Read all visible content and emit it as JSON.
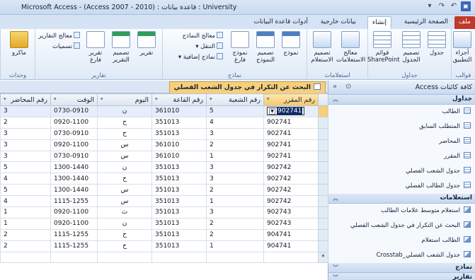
{
  "app": {
    "window_title": "Microsoft Access - (Access 2007 - 2010) : قاعدة بيانات : University"
  },
  "ribbon": {
    "tabs": [
      "ملف",
      "الصفحة الرئيسية",
      "إنشاء",
      "بيانات خارجية",
      "أدوات قاعدة البيانات"
    ],
    "active_tab": "إنشاء",
    "groups": {
      "templates": {
        "label": "قوالب",
        "app_parts": "أجزاء التطبيق"
      },
      "tables": {
        "label": "جداول",
        "table": "جدول",
        "table_design": "تصميم الجدول",
        "sharepoint": "قوائم SharePoint"
      },
      "queries": {
        "label": "استعلامات",
        "wizard": "معالج الاستعلامات",
        "design": "تصميم الاستعلام"
      },
      "forms": {
        "label": "نماذج",
        "form": "نموذج",
        "form_design": "تصميم النموذج",
        "blank_form": "نموذج فارغ",
        "form_wizard": "معالج النماذج",
        "navigation": "التنقل",
        "more_forms": "نماذج إضافية"
      },
      "reports": {
        "label": "تقارير",
        "report": "تقرير",
        "report_design": "تصميم التقرير",
        "blank_report": "تقرير فارغ",
        "report_wizard": "معالج التقارير",
        "labels": "تسميات"
      },
      "macros": {
        "label": "وحدات",
        "macro": "ماكرو"
      }
    }
  },
  "nav_pane": {
    "title": "كافة كائنات Access",
    "sections": [
      {
        "label": "جداول",
        "items": [
          "الطالب",
          "المتطلب السابق",
          "المحاضر",
          "المقرر",
          "جدول الشعب الفصلي",
          "جدول الطالب الفصلي"
        ]
      },
      {
        "label": "استعلامات",
        "items": [
          "استعلام متوسط علامات الطالب",
          "البحث عن التكرار في جدول الشعب الفصلي",
          "الطالب استعلام",
          "جدول الشعب الفصلي_Crosstab"
        ]
      },
      {
        "label": "نماذج",
        "items": []
      },
      {
        "label": "تقارير",
        "items": []
      }
    ]
  },
  "document": {
    "tab_title": "البحث عن التكرار في جدول الشعب الفصلي",
    "columns": [
      "رقم المقرر",
      "رقم الشعبة",
      "رقم القاعة",
      "اليوم",
      "الوقت",
      "رقم المحاضر"
    ],
    "rows": [
      [
        "902741",
        "5",
        "361010",
        "ن",
        "0730-0910",
        "3"
      ],
      [
        "902741",
        "4",
        "351013",
        "ح",
        "0920-1100",
        "2"
      ],
      [
        "902741",
        "3",
        "351013",
        "ح",
        "0730-0910",
        "3"
      ],
      [
        "902741",
        "2",
        "361010",
        "س",
        "0920-1100",
        "3"
      ],
      [
        "902741",
        "1",
        "361010",
        "س",
        "0730-0910",
        "3"
      ],
      [
        "902742",
        "3",
        "351013",
        "ن",
        "1300-1440",
        "5"
      ],
      [
        "902742",
        "3",
        "351013",
        "ح",
        "1300-1440",
        "4"
      ],
      [
        "902742",
        "2",
        "351013",
        "س",
        "1300-1440",
        "5"
      ],
      [
        "902742",
        "1",
        "351013",
        "س",
        "1115-1255",
        "4"
      ],
      [
        "902743",
        "3",
        "351013",
        "ث",
        "0920-1100",
        "1"
      ],
      [
        "902743",
        "2",
        "351013",
        "ن",
        "0920-1100",
        "1"
      ],
      [
        "904741",
        "2",
        "351013",
        "ح",
        "1115-1255",
        "2"
      ],
      [
        "904741",
        "1",
        "351013",
        "ح",
        "1115-1255",
        "2"
      ]
    ]
  }
}
